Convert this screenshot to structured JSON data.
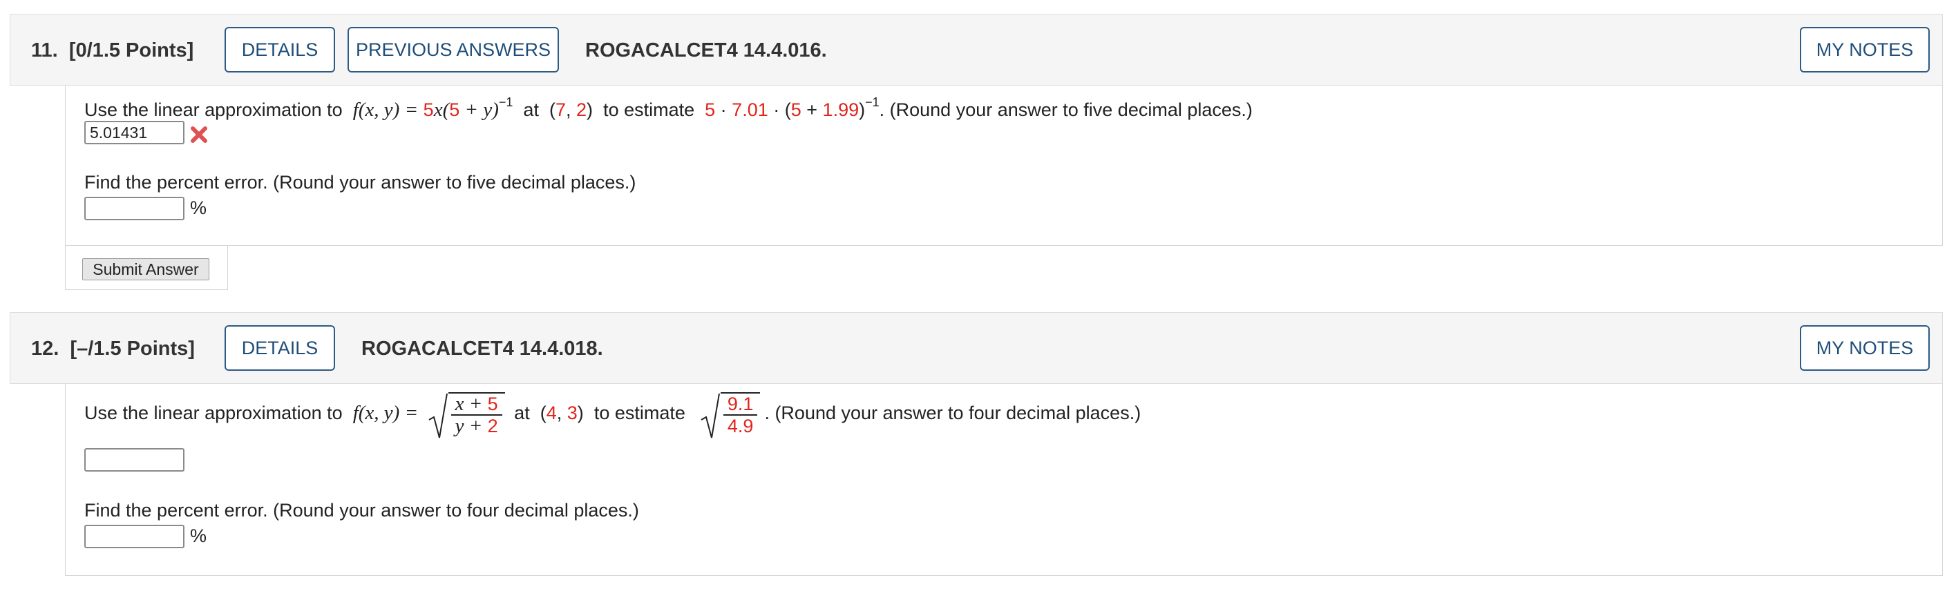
{
  "q11": {
    "number": "11.",
    "points": "[0/1.5 Points]",
    "details_label": "DETAILS",
    "prev_answers_label": "PREVIOUS ANSWERS",
    "code": "ROGACALCET4 14.4.016.",
    "notes_label": "MY NOTES",
    "prompt_start": "Use the linear approximation to",
    "f_label": "f(x, y) =",
    "f_coef": "5",
    "f_mid1": "x(",
    "f_coef2": "5",
    "f_mid2": " + y)",
    "f_exp": "−1",
    "at_word": "at",
    "point_open": "(",
    "point_x": "7",
    "point_sep": ", ",
    "point_y": "2",
    "point_close": ")",
    "to_estimate": "to estimate",
    "est_a": "5",
    "est_dot": " · ",
    "est_b": "7.01",
    "est_dot2": " · (",
    "est_c": "5",
    "est_plus": " + ",
    "est_d": "1.99",
    "est_close": ")",
    "est_exp": "−1",
    "prompt_end": ". (Round your answer to five decimal places.)",
    "answer_value": "5.01431",
    "answer_status": "incorrect",
    "error_prompt": "Find the percent error. (Round your answer to five decimal places.)",
    "error_value": "",
    "percent_sign": "%",
    "submit_label": "Submit Answer"
  },
  "q12": {
    "number": "12.",
    "points": "[–/1.5 Points]",
    "details_label": "DETAILS",
    "code": "ROGACALCET4 14.4.018.",
    "notes_label": "MY NOTES",
    "prompt_start": "Use the linear approximation to",
    "f_label": "f(x, y) =",
    "num_var": "x + ",
    "num_const": "5",
    "den_var": "y + ",
    "den_const": "2",
    "at_word": "at",
    "point_open": "(",
    "point_x": "4",
    "point_sep": ", ",
    "point_y": "3",
    "point_close": ")",
    "to_estimate": "to estimate",
    "est_num": "9.1",
    "est_den": "4.9",
    "prompt_end": ". (Round your answer to four decimal places.)",
    "answer_value": "",
    "error_prompt": "Find the percent error. (Round your answer to four decimal places.)",
    "error_value": "",
    "percent_sign": "%"
  },
  "colors": {
    "accent": "#1f4e79",
    "highlight": "#e2231a",
    "wrong_mark": "#e05252"
  },
  "icons": {
    "wrong": "close-icon"
  }
}
